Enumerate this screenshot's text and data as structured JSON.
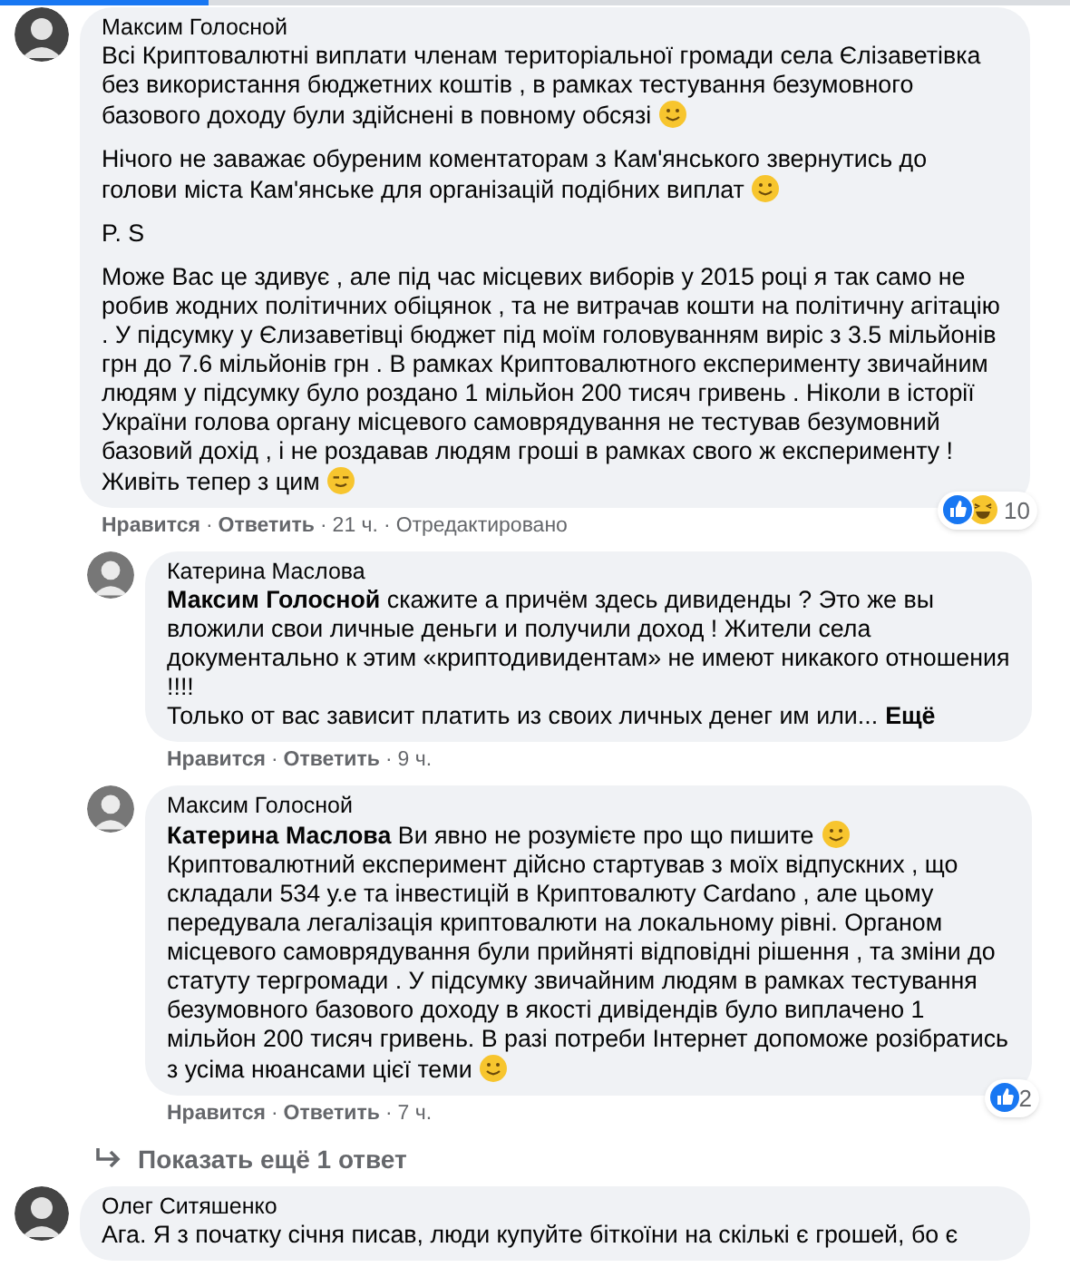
{
  "comments": [
    {
      "author": "Максим Голосной",
      "paragraphs": [
        {
          "text": "Всі Криптовалютні виплати членам територіальної громади села Єлізаветівка без використання бюджетних коштів , в рамках тестування безумовного базового доходу були здійснені в повному обсязі",
          "smiley": true
        },
        {
          "text": "Нічого не заважає обуреним коментаторам з Кам'янського звернутись до голови міста Кам'янське для організацій подібних виплат",
          "smiley": true
        },
        {
          "text": "P. S"
        },
        {
          "text": "Може Вас це здивує , але під час місцевих виборів у 2015 році я так само не робив жодних політичних обіцянок , та не витрачав кошти на політичну агітацію . У підсумку у Єлизаветівці бюджет під моїм головуванням виріс з 3.5 мільйонів грн до 7.6 мільйонів грн . В рамках Криптовалютного експерименту звичайним людям у підсумку було роздано 1 мільйон 200 тисяч гривень . Ніколи в історії України голова органу місцевого самоврядування не тестував безумовний базовий дохід , і не роздавав людям гроші в рамках свого ж експерименту ! Живіть тепер з цим",
          "winking": true
        }
      ],
      "actions": [
        "Нравится",
        "Ответить",
        "21 ч.",
        "Отредактировано"
      ],
      "separator": "·",
      "reactions": {
        "like": true,
        "haha": true,
        "count": "10"
      },
      "replies": [
        {
          "author": "Катерина Маслова",
          "paragraphs": [
            {
              "text": "**Максим Голосной** скажите а причём здесь дивиденды ? Это же вы вложили свои личные деньги и получили доход ! Жители села документально к этим «криптодивидентам» не имеют никакого отношения !!!!"
            },
            {
              "text": "Только от вас зависит платить из своих личных денег им или...",
              "more": "Ещё"
            }
          ],
          "actions": [
            "Нравится",
            "Ответить",
            "9 ч."
          ],
          "separator": "·"
        },
        {
          "author": "Максим Голосной",
          "paragraphs": [
            {
              "text": "**Катерина Маслова** Ви явно не розумієте про що пишите",
              "smiley": true
            },
            {
              "text": "Криптовалютний експеримент дійсно стартував з моїх відпускних , що складали 534 у.е та інвестицій в Криптовалюту Cardano , але цьому передувала легалізація криптовалюти на локальному рівні. Органом місцевого самоврядування були прийняті відповідні рішення , та зміни до статуту тергромади . У підсумку звичайним людям в рамках тестування безумовного базового доходу в якості дивідендів було виплачено 1 мільйон 200 тисяч гривень. В разі потреби Інтернет допоможе розібратись з усіма нюансами цієї теми",
              "smiley": true
            }
          ],
          "actions": [
            "Нравится",
            "Ответить",
            "7 ч."
          ],
          "separator": "·",
          "reactions": {
            "like": true,
            "count": "2"
          }
        }
      ],
      "more_replies": "Показать ещё 1 ответ"
    },
    {
      "author": "Олег Ситяшенко",
      "paragraphs": [
        {
          "text": "Ага. Я з початку січня писав, люди купуйте біткоїни на скількі є грошей, бо є"
        }
      ]
    }
  ]
}
